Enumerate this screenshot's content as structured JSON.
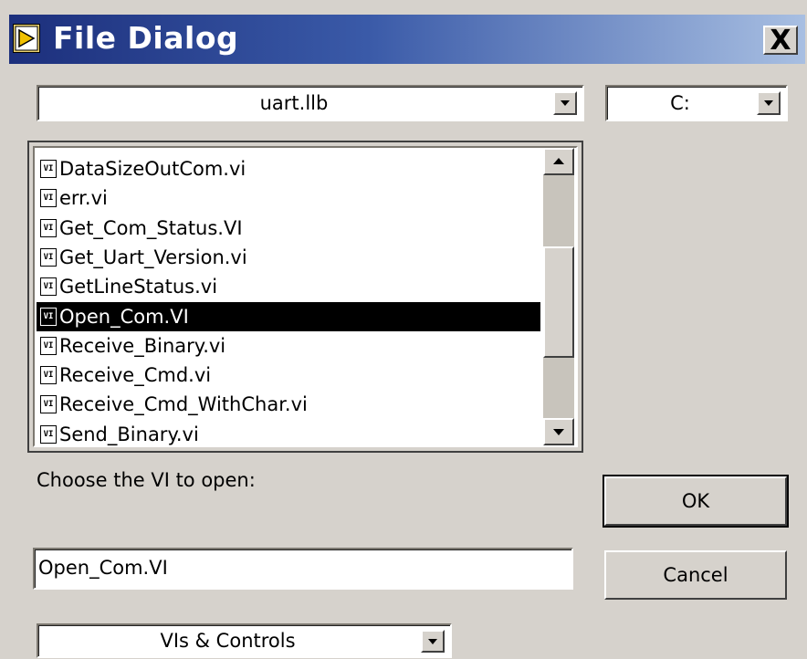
{
  "window": {
    "title": "File Dialog",
    "close_label": "X"
  },
  "location": {
    "folder": "uart.llb",
    "drive": "C:"
  },
  "file_list": {
    "items": [
      {
        "icon": "vi-file-icon",
        "icon_text": "VI",
        "name": "DataSizeOutCom.vi",
        "selected": false
      },
      {
        "icon": "vi-file-icon",
        "icon_text": "VI",
        "name": "err.vi",
        "selected": false
      },
      {
        "icon": "vi-file-icon",
        "icon_text": "VI",
        "name": "Get_Com_Status.VI",
        "selected": false
      },
      {
        "icon": "vi-file-icon",
        "icon_text": "VI",
        "name": "Get_Uart_Version.vi",
        "selected": false
      },
      {
        "icon": "vi-file-icon",
        "icon_text": "VI",
        "name": "GetLineStatus.vi",
        "selected": false
      },
      {
        "icon": "vi-file-icon",
        "icon_text": "VI",
        "name": "Open_Com.VI",
        "selected": true
      },
      {
        "icon": "vi-file-icon",
        "icon_text": "VI",
        "name": "Receive_Binary.vi",
        "selected": false
      },
      {
        "icon": "vi-file-icon",
        "icon_text": "VI",
        "name": "Receive_Cmd.vi",
        "selected": false
      },
      {
        "icon": "vi-file-icon",
        "icon_text": "VI",
        "name": "Receive_Cmd_WithChar.vi",
        "selected": false
      },
      {
        "icon": "vi-file-icon",
        "icon_text": "VI",
        "name": "Send_Binary.vi",
        "selected": false
      }
    ]
  },
  "prompt": {
    "label": "Choose the VI to open:"
  },
  "filename_field": {
    "value": "Open_Com.VI"
  },
  "filter": {
    "selected": "VIs & Controls"
  },
  "buttons": {
    "ok_label": "OK",
    "cancel_label": "Cancel"
  },
  "colors": {
    "titlebar_start": "#1c2f7c",
    "titlebar_end": "#a8bfe2",
    "dialog_background": "#d6d2cc",
    "selection_background": "#000000",
    "selection_text": "#ffffff"
  }
}
